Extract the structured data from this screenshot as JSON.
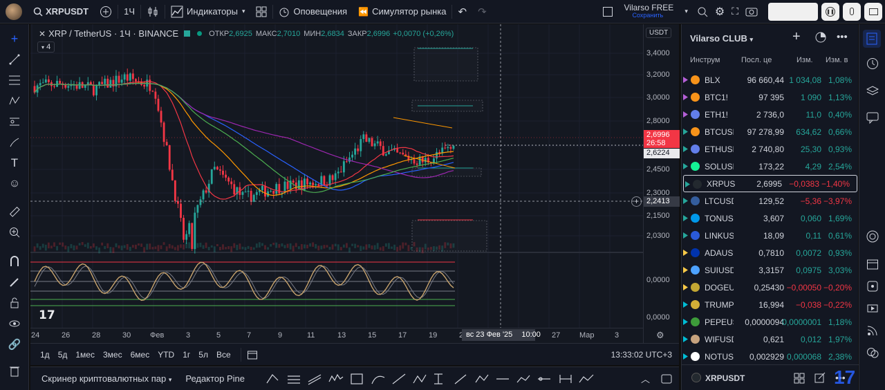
{
  "top": {
    "symbol": "XRPUSDT",
    "interval": "1Ч",
    "indicators": "Индикаторы",
    "alerts": "Оповещения",
    "replay": "Симулятор рынка",
    "user_name": "Vilarso FREE",
    "save": "Сохранить"
  },
  "legend": {
    "title": "XRP / TetherUS · 1Ч · BINANCE",
    "open_label": "ОТКР",
    "open": "2,6925",
    "high_label": "МАКС",
    "high": "2,7010",
    "low_label": "МИН",
    "low": "2,6834",
    "close_label": "ЗАКР",
    "close": "2,6996",
    "change": "+0,0070 (+0,26%)",
    "collapse_count": "4"
  },
  "price_axis": {
    "currency": "USDT",
    "labels": [
      "3,4000",
      "3,2000",
      "3,0000",
      "2,8000",
      "2,6224",
      "2,4500",
      "2,3000",
      "2,1500",
      "2,0300"
    ],
    "current_price": "2,6996",
    "countdown": "26:58",
    "crosshair_price": "2,2413",
    "osc_labels": [
      "0,0000",
      "0,0000"
    ]
  },
  "time_axis": {
    "labels": [
      "24",
      "26",
      "28",
      "30",
      "Фев",
      "3",
      "5",
      "7",
      "9",
      "11",
      "13",
      "15",
      "17",
      "19",
      "21",
      "27",
      "Мар",
      "3"
    ],
    "crosshair_date": "вс 23 Фев '25",
    "crosshair_time": "10:00"
  },
  "ranges": [
    "1д",
    "5д",
    "1мес",
    "3мес",
    "6мес",
    "YTD",
    "1г",
    "5л",
    "Все"
  ],
  "clock": "13:33:02 UTC+3",
  "bottom": {
    "screener": "Скринер криптовалютных пар",
    "pine": "Редактор Pine"
  },
  "watchlist": {
    "title": "Vilarso CLUB",
    "col_symbol": "Инструм",
    "col_last": "Посл. це",
    "col_chg": "Изм.",
    "col_chgp": "Изм. в",
    "rows": [
      {
        "sym": "BLX",
        "last": "96 660,44",
        "chg": "1 034,08",
        "chp": "1,08%",
        "dir": "pos",
        "logo": "#f7931a",
        "flag": "#b45fd6"
      },
      {
        "sym": "BTC1!",
        "last": "97 395",
        "chg": "1 090",
        "chp": "1,13%",
        "dir": "pos",
        "logo": "#f7931a",
        "flag": "#b45fd6"
      },
      {
        "sym": "ETH1!",
        "last": "2 736,0",
        "chg": "11,0",
        "chp": "0,40%",
        "dir": "pos",
        "logo": "#627eea",
        "flag": "#b45fd6"
      },
      {
        "sym": "BTCUSD",
        "last": "97 278,99",
        "chg": "634,62",
        "chp": "0,66%",
        "dir": "pos",
        "logo": "#f7931a",
        "flag": "#26a69a"
      },
      {
        "sym": "ETHUSD",
        "last": "2 740,80",
        "chg": "25,30",
        "chp": "0,93%",
        "dir": "pos",
        "logo": "#627eea",
        "flag": "#26a69a"
      },
      {
        "sym": "SOLUSD",
        "last": "173,22",
        "chg": "4,29",
        "chp": "2,54%",
        "dir": "pos",
        "logo": "#14f195",
        "flag": "#26a69a"
      },
      {
        "sym": "XRPUSDT",
        "last": "2,6995",
        "chg": "−0,0383",
        "chp": "−1,40%",
        "dir": "neg",
        "logo": "#23292f",
        "flag": "#26a69a"
      },
      {
        "sym": "LTCUSD",
        "last": "129,52",
        "chg": "−5,36",
        "chp": "−3,97%",
        "dir": "neg",
        "logo": "#345d9d",
        "flag": "#26a69a"
      },
      {
        "sym": "TONUSD",
        "last": "3,607",
        "chg": "0,060",
        "chp": "1,69%",
        "dir": "pos",
        "logo": "#0098ea",
        "flag": "#26a69a"
      },
      {
        "sym": "LINKUSD",
        "last": "18,09",
        "chg": "0,11",
        "chp": "0,61%",
        "dir": "pos",
        "logo": "#2a5ada",
        "flag": "#26a69a"
      },
      {
        "sym": "ADAUSD",
        "last": "0,7810",
        "chg": "0,0072",
        "chp": "0,93%",
        "dir": "pos",
        "logo": "#0033ad",
        "flag": "#f7c948"
      },
      {
        "sym": "SUIUSDT",
        "last": "3,3157",
        "chg": "0,0975",
        "chp": "3,03%",
        "dir": "pos",
        "logo": "#4da2ff",
        "flag": "#f7c948"
      },
      {
        "sym": "DOGEUSD",
        "last": "0,25430",
        "chg": "−0,00050",
        "chp": "−0,20%",
        "dir": "neg",
        "logo": "#c2a633",
        "flag": "#f7c948"
      },
      {
        "sym": "TRUMPUSD",
        "last": "16,994",
        "chg": "−0,038",
        "chp": "−0,22%",
        "dir": "neg",
        "logo": "#d4af37",
        "flag": "#00bcd4"
      },
      {
        "sym": "PEPEUSD",
        "last": "0,0000094",
        "chg": "0,0000001",
        "chp": "1,18%",
        "dir": "pos",
        "logo": "#3d9b3a",
        "flag": "#00bcd4"
      },
      {
        "sym": "WIFUSD",
        "last": "0,621",
        "chg": "0,012",
        "chp": "1,97%",
        "dir": "pos",
        "logo": "#c6a27e",
        "flag": "#00bcd4"
      },
      {
        "sym": "NOTUSD",
        "last": "0,002929",
        "chg": "0,000068",
        "chp": "2,38%",
        "dir": "pos",
        "logo": "#ffffff",
        "flag": "#00bcd4"
      }
    ],
    "footer_symbol": "XRPUSDT"
  },
  "chart_data": {
    "type": "line",
    "title": "XRP / TetherUS · 1Ч · BINANCE",
    "x": [
      "24",
      "26",
      "28",
      "30",
      "Фев",
      "3",
      "5",
      "7",
      "9",
      "11",
      "13",
      "15",
      "17",
      "19",
      "21"
    ],
    "series": [
      {
        "values": [
          3.12,
          3.14,
          3.1,
          3.18,
          3.12,
          2.05,
          2.55,
          2.35,
          2.42,
          2.45,
          2.48,
          2.75,
          2.65,
          2.6,
          2.7
        ]
      }
    ],
    "ylim": [
      2.0,
      3.45
    ],
    "xlabel": "",
    "ylabel": ""
  },
  "colors": {
    "up": "#26a69a",
    "down": "#f23645",
    "bg": "#141821",
    "accent": "#2962ff"
  }
}
